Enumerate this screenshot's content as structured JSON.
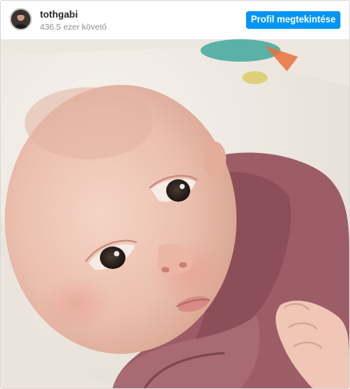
{
  "post": {
    "username": "tothgabi",
    "followers": "436.5 ezer követő",
    "profile_button_label": "Profil megtekintése"
  },
  "icons": {
    "avatar": "profile-avatar"
  },
  "colors": {
    "button_bg": "#0095f6",
    "button_text": "#ffffff",
    "username": "#262626",
    "subtext": "#8e8e8e",
    "sweater": "#9a5b63",
    "skin": "#edc3b3",
    "blanket": "#f1ece6"
  }
}
